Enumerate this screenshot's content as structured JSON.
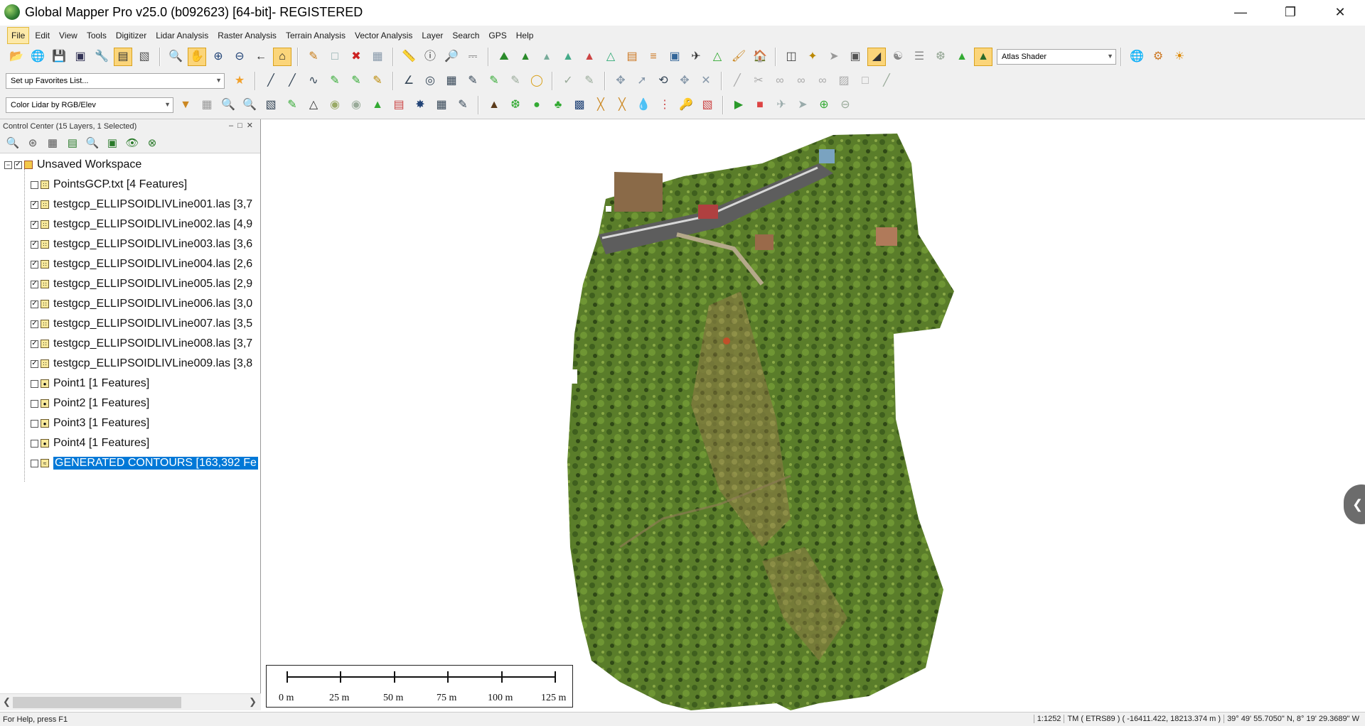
{
  "window": {
    "title": "Global Mapper Pro v25.0 (b092623) [64-bit]- REGISTERED",
    "minimize_icon": "minimize-icon",
    "restore_icon": "restore-icon",
    "close_icon": "close-icon"
  },
  "menu": {
    "items": [
      "File",
      "Edit",
      "View",
      "Tools",
      "Digitizer",
      "Lidar Analysis",
      "Raster Analysis",
      "Terrain Analysis",
      "Vector Analysis",
      "Layer",
      "Search",
      "GPS",
      "Help"
    ],
    "active": "File"
  },
  "toolbar": {
    "shader_select": "Atlas Shader",
    "favorites_select": "Set up Favorites List...",
    "lidar_color_select": "Color Lidar by RGB/Elev"
  },
  "control_center": {
    "title": "Control Center (15 Layers, 1 Selected)",
    "workspace": "Unsaved Workspace",
    "layers": [
      {
        "label": "PointsGCP.txt [4 Features]",
        "checked": false
      },
      {
        "label": "testgcp_ELLIPSOIDLIVLine001.las [3,7",
        "checked": true
      },
      {
        "label": "testgcp_ELLIPSOIDLIVLine002.las [4,9",
        "checked": true
      },
      {
        "label": "testgcp_ELLIPSOIDLIVLine003.las [3,6",
        "checked": true
      },
      {
        "label": "testgcp_ELLIPSOIDLIVLine004.las [2,6",
        "checked": true
      },
      {
        "label": "testgcp_ELLIPSOIDLIVLine005.las [2,9",
        "checked": true
      },
      {
        "label": "testgcp_ELLIPSOIDLIVLine006.las [3,0",
        "checked": true
      },
      {
        "label": "testgcp_ELLIPSOIDLIVLine007.las [3,5",
        "checked": true
      },
      {
        "label": "testgcp_ELLIPSOIDLIVLine008.las [3,7",
        "checked": true
      },
      {
        "label": "testgcp_ELLIPSOIDLIVLine009.las [3,8",
        "checked": true
      },
      {
        "label": "Point1 [1 Features]",
        "checked": false
      },
      {
        "label": "Point2 [1 Features]",
        "checked": false
      },
      {
        "label": "Point3 [1 Features]",
        "checked": false
      },
      {
        "label": "Point4 [1 Features]",
        "checked": false
      },
      {
        "label": "GENERATED CONTOURS [163,392 Fe",
        "checked": false,
        "selected": true
      }
    ]
  },
  "scale_bar": {
    "labels": [
      "0 m",
      "25 m",
      "50 m",
      "75 m",
      "100 m",
      "125 m"
    ]
  },
  "status": {
    "help": "For Help, press F1",
    "scale": "1:1252",
    "projection": "TM ( ETRS89 ) ( -16411.422, 18213.374 m )",
    "latlon": "39° 49' 55.7050\" N, 8° 19' 29.3689\" W"
  },
  "colors": {
    "selection": "#0078d7",
    "toolbar_bg": "#f0f0f0",
    "active_tool": "#fbd57a"
  }
}
